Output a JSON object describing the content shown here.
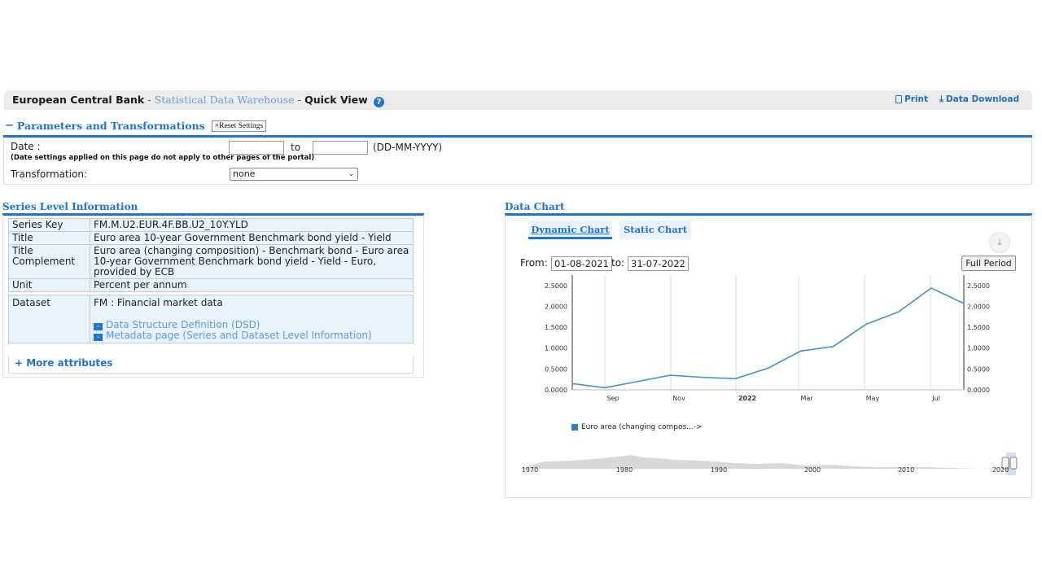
{
  "header": {
    "org": "European Central Bank",
    "dash1": " - ",
    "warehouse": "Statistical Data Warehouse",
    "dash2": " - ",
    "view": "Quick View",
    "print": "Print",
    "download": "Data Download"
  },
  "params": {
    "toggle": "−",
    "title": "Parameters and Transformations",
    "reset": "Reset Settings",
    "date_label": "Date :",
    "to": "to",
    "format": "(DD-MM-YYYY)",
    "note": "(Date settings applied on this page do not apply to other pages of the portal)",
    "transformation_label": "Transformation:",
    "transformation_value": "none",
    "date_from": "",
    "date_to": ""
  },
  "series": {
    "title": "Series Level Information",
    "rows": [
      {
        "key": "Series Key",
        "value": "FM.M.U2.EUR.4F.BB.U2_10Y.YLD"
      },
      {
        "key": "Title",
        "value": "Euro area 10-year Government Benchmark bond yield - Yield"
      },
      {
        "key": "Title Complement",
        "value": "Euro area (changing composition) - Benchmark bond - Euro area 10-year Government Benchmark bond yield - Yield - Euro, provided by ECB"
      },
      {
        "key": "Unit",
        "value": "Percent per annum"
      },
      {
        "key": "Dataset",
        "value": "FM : Financial market data"
      }
    ],
    "link_dsd": "Data Structure Definition (DSD)",
    "link_meta": "Metadata page (Series and Dataset Level Information)",
    "more": "+ More attributes"
  },
  "chart_panel": {
    "title": "Data Chart",
    "tab_dynamic": "Dynamic Chart",
    "tab_static": "Static Chart",
    "from_label": "From:",
    "to_label": "to:",
    "from_value": "01-08-2021",
    "to_value": "31-07-2022",
    "full_period": "Full Period",
    "legend": "Euro area (changing compos...->",
    "series_color": "#4a90c8"
  },
  "chart_data": {
    "type": "line",
    "x": [
      "2021-08",
      "2021-09",
      "2021-10",
      "2021-11",
      "2021-12",
      "2022-01",
      "2022-02",
      "2022-03",
      "2022-04",
      "2022-05",
      "2022-06",
      "2022-07"
    ],
    "series": [
      {
        "name": "Euro area (changing compos...->",
        "values": [
          0.15,
          0.05,
          0.2,
          0.35,
          0.3,
          0.27,
          0.52,
          0.93,
          1.04,
          1.57,
          1.87,
          2.44,
          2.07
        ]
      }
    ],
    "x_tick_labels": [
      "Sep",
      "Nov",
      "2022",
      "Mar",
      "May",
      "Jul"
    ],
    "y_tick_labels": [
      "0.0000",
      "0.5000",
      "1.0000",
      "1.5000",
      "2.0000",
      "2.5000"
    ],
    "ylim": [
      0,
      2.75
    ],
    "navigator_labels": [
      "1970",
      "1980",
      "1990",
      "2000",
      "2010",
      "2020"
    ],
    "grid": true
  }
}
